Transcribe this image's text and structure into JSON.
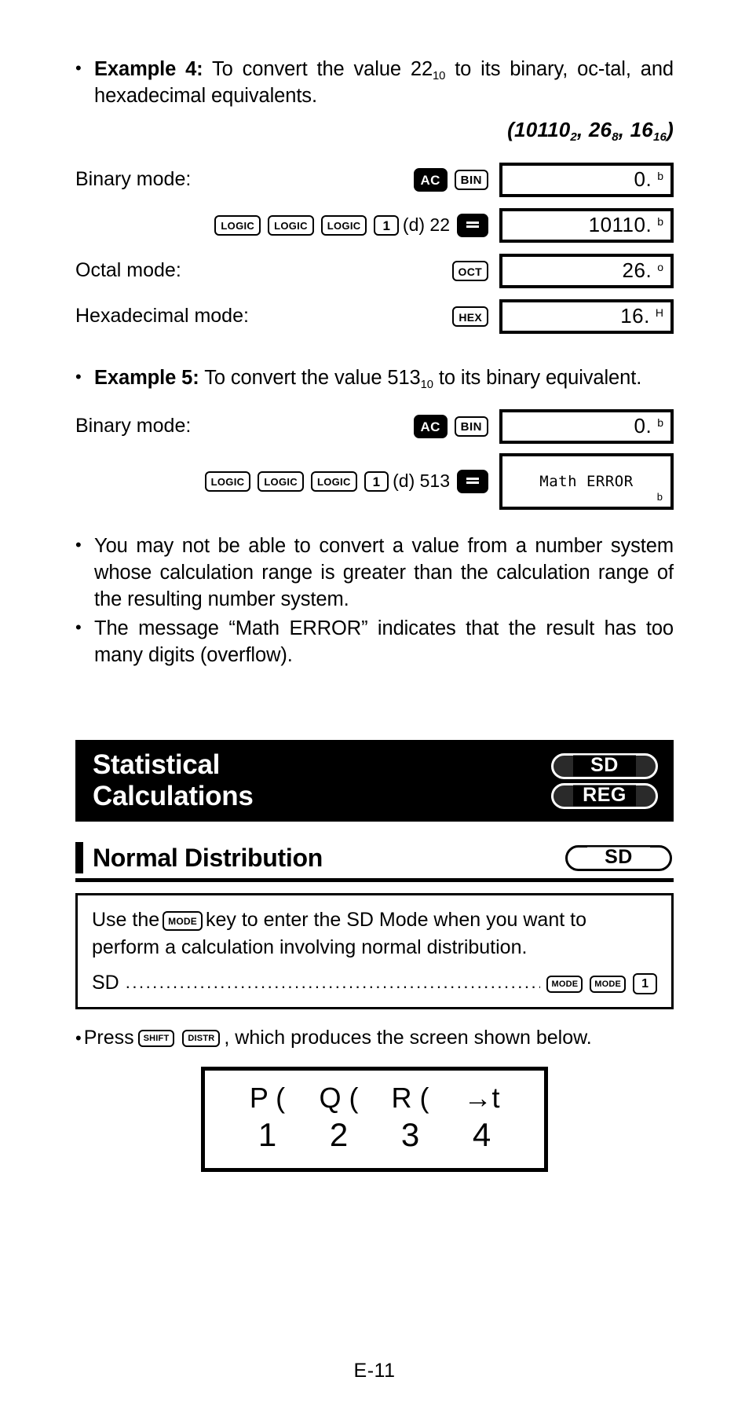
{
  "page": {
    "footer": "E-11"
  },
  "example4": {
    "bullet": "•",
    "lead": "Example 4:",
    "text_a": "To convert the value 22",
    "sub_a": "10",
    "text_b": " to its binary, oc-tal, and hexadecimal equivalents.",
    "answer": {
      "open": "(",
      "v1": "10110",
      "s1": "2",
      "sep1": ", ",
      "v2": "26",
      "s2": "8",
      "sep2": ", ",
      "v3": "16",
      "s3": "16",
      "close": ")"
    },
    "rows": [
      {
        "label": "Binary mode:",
        "keys": [
          "AC",
          "BIN"
        ],
        "display": {
          "value": "0.",
          "mark": "b"
        }
      },
      {
        "label": "",
        "keys": [
          "LOGIC",
          "LOGIC",
          "LOGIC",
          "1"
        ],
        "suffix": "(d) 22",
        "eq": "=",
        "display": {
          "value": "10110.",
          "mark": "b"
        }
      },
      {
        "label": "Octal mode:",
        "keys": [
          "OCT"
        ],
        "display": {
          "value": "26.",
          "mark": "o"
        }
      },
      {
        "label": "Hexadecimal mode:",
        "keys": [
          "HEX"
        ],
        "display": {
          "value": "16.",
          "mark": "H"
        }
      }
    ]
  },
  "example5": {
    "bullet": "•",
    "lead": "Example 5:",
    "text_a": "To convert the value 513",
    "sub_a": "10",
    "text_b": " to its binary equivalent.",
    "rows": [
      {
        "label": "Binary mode:",
        "keys": [
          "AC",
          "BIN"
        ],
        "display": {
          "value": "0.",
          "mark": "b"
        }
      },
      {
        "label": "",
        "keys": [
          "LOGIC",
          "LOGIC",
          "LOGIC",
          "1"
        ],
        "suffix": "(d) 513",
        "eq": "=",
        "display": {
          "error": "Math ERROR",
          "mark": "b"
        }
      }
    ]
  },
  "notes": [
    {
      "bullet": "•",
      "text": "You may not be able to convert a value from a number system whose calculation range is greater than the calculation range of the resulting number system."
    },
    {
      "bullet": "•",
      "text": "The message “Math ERROR” indicates that the result has too many digits (overflow)."
    }
  ],
  "section": {
    "title": "Statistical\nCalculations",
    "badges": [
      {
        "label": "SD"
      },
      {
        "label": "REG"
      }
    ]
  },
  "subsection": {
    "title": "Normal Distribution",
    "badge": {
      "label": "SD"
    }
  },
  "infobox": {
    "text_a": "Use the",
    "key_mode": "MODE",
    "text_b": "key to enter the SD Mode when you want to perform a calculation involving normal distribution.",
    "entry": {
      "name": "SD",
      "leader": "..................................................................",
      "keys": [
        "MODE",
        "MODE",
        "1"
      ]
    }
  },
  "press": {
    "bullet": "•",
    "text_a": "Press",
    "key1": "SHIFT",
    "key2": "DISTR",
    "text_b": ", which produces the screen shown below."
  },
  "screen": {
    "top": [
      "P (",
      "Q (",
      "R (",
      "→t"
    ],
    "bottom": [
      "1",
      "2",
      "3",
      "4"
    ]
  }
}
